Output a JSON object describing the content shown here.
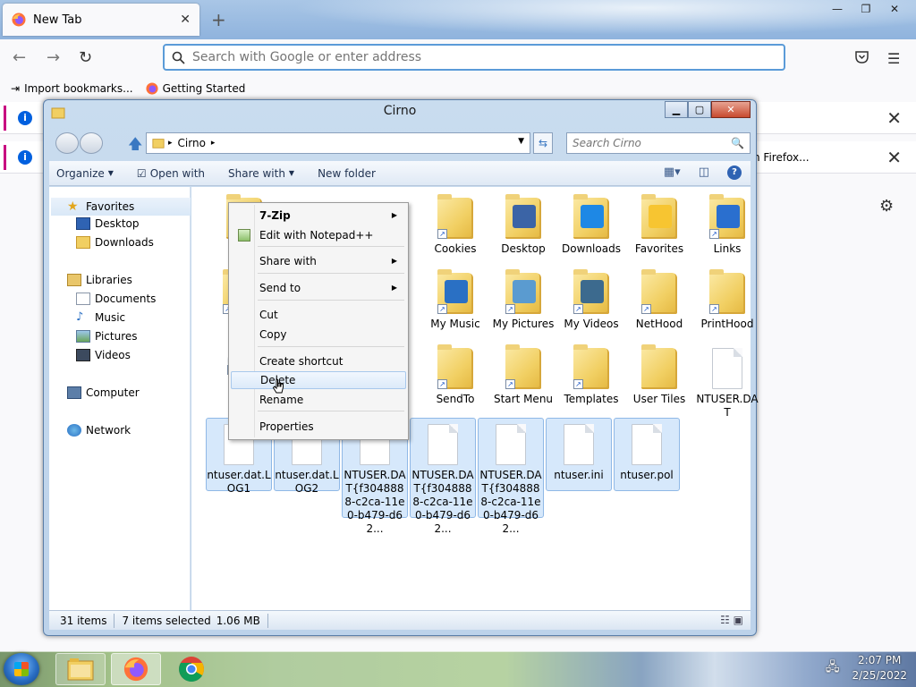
{
  "browser": {
    "tab_title": "New Tab",
    "tab_close": "✕",
    "new_tab": "+",
    "window_controls": {
      "minimize": "—",
      "restore": "❐",
      "close": "✕"
    },
    "address_placeholder": "Search with Google or enter address",
    "bookmarks": [
      {
        "label": "Import bookmarks...",
        "icon": "import-icon"
      },
      {
        "label": "Getting Started",
        "icon": "firefox-icon"
      }
    ],
    "notification_2_text": "h Firefox...",
    "icons": {
      "back": "back-arrow-icon",
      "forward": "forward-arrow-icon",
      "reload": "reload-icon",
      "pocket": "pocket-icon",
      "menu": "hamburger-menu-icon",
      "settings": "gear-icon"
    }
  },
  "explorer": {
    "title": "Cirno",
    "address_crumb": "Cirno",
    "search_placeholder": "Search Cirno",
    "commands": [
      {
        "label": "Organize",
        "dropdown": true
      },
      {
        "label": "Open with",
        "dropdown": false
      },
      {
        "label": "Share with",
        "dropdown": true
      },
      {
        "label": "New folder",
        "dropdown": false
      }
    ],
    "nav": {
      "favorites": "Favorites",
      "favorites_items": [
        "Desktop",
        "Downloads"
      ],
      "libraries": "Libraries",
      "libraries_items": [
        "Documents",
        "Music",
        "Pictures",
        "Videos"
      ],
      "computer": "Computer",
      "network": "Network"
    },
    "files_row1_partial": [
      "Ap"
    ],
    "files": [
      {
        "label": "Cookies",
        "type": "folder",
        "shortcut": true
      },
      {
        "label": "Desktop",
        "type": "folder",
        "overlay": "#3b64a6"
      },
      {
        "label": "Downloads",
        "type": "folder",
        "overlay": "#1e88e5"
      },
      {
        "label": "Favorites",
        "type": "folder",
        "overlay": "#f7c531"
      },
      {
        "label": "Links",
        "type": "folder",
        "overlay": "#2a6fcf",
        "shortcut": true
      },
      {
        "label": "My Music",
        "type": "folder",
        "overlay": "#2a70c4",
        "shortcut": true
      },
      {
        "label": "My Pictures",
        "type": "folder",
        "overlay": "#5a9bd0",
        "shortcut": true
      },
      {
        "label": "My Videos",
        "type": "folder",
        "overlay": "#3c6a8e",
        "shortcut": true
      },
      {
        "label": "NetHood",
        "type": "folder",
        "shortcut": true
      },
      {
        "label": "PrintHood",
        "type": "folder",
        "shortcut": true
      },
      {
        "label": "SendTo",
        "type": "folder",
        "shortcut": true
      },
      {
        "label": "Start Menu",
        "type": "folder",
        "shortcut": true
      },
      {
        "label": "Templates",
        "type": "folder",
        "shortcut": true
      },
      {
        "label": "User Tiles",
        "type": "folder"
      },
      {
        "label": "NTUSER.DAT",
        "type": "doc"
      },
      {
        "label": "ntuser.dat.LOG1",
        "type": "doc",
        "selected": true
      },
      {
        "label": "ntuser.dat.LOG2",
        "type": "doc",
        "selected": true
      },
      {
        "label": "NTUSER.DAT{f3048888-c2ca-11e0-b479-d62...",
        "type": "doc",
        "selected": true
      },
      {
        "label": "NTUSER.DAT{f3048888-c2ca-11e0-b479-d62...",
        "type": "doc",
        "selected": true
      },
      {
        "label": "NTUSER.DAT{f3048888-c2ca-11e0-b479-d62...",
        "type": "doc",
        "selected": true
      },
      {
        "label": "ntuser.ini",
        "type": "doc",
        "selected": true
      },
      {
        "label": "ntuser.pol",
        "type": "doc",
        "selected": true
      }
    ],
    "left_partial_labels": [
      "L",
      "Se",
      "R"
    ],
    "status": {
      "items": "31 items",
      "selected": "7 items selected",
      "size": "1.06 MB"
    }
  },
  "context_menu": {
    "items": [
      {
        "label": "7-Zip",
        "bold": true,
        "submenu": true
      },
      {
        "label": "Edit with Notepad++",
        "icon": "notepad-plus-plus-icon"
      },
      {
        "label": "Share with",
        "submenu": true
      },
      {
        "label": "Send to",
        "submenu": true
      },
      {
        "label": "Cut"
      },
      {
        "label": "Copy"
      },
      {
        "label": "Create shortcut"
      },
      {
        "label": "Delete",
        "highlighted": true
      },
      {
        "label": "Rename"
      },
      {
        "label": "Properties"
      }
    ]
  },
  "taskbar": {
    "clock_time": "2:07 PM",
    "clock_date": "2/25/2022",
    "apps": [
      "file-explorer-icon",
      "firefox-icon",
      "chrome-icon"
    ]
  },
  "colors": {
    "accent": "#0060df",
    "selection": "#d6e8fb",
    "notification_bar": "#c80080"
  }
}
